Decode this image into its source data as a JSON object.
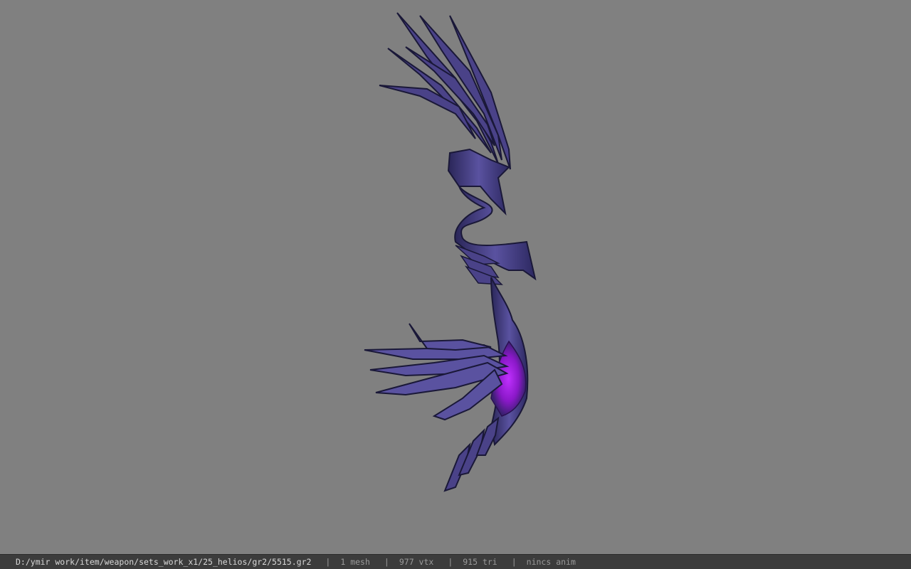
{
  "viewer": {
    "background_color": "#808080",
    "model_colors": {
      "body": "#4a4288",
      "highlight": "#7a72c0",
      "shadow": "#1a1838",
      "glow": "#a020e0"
    }
  },
  "status_bar": {
    "file_path": "D:/ymir work/item/weapon/sets_work_x1/25_helios/gr2/5515.gr2",
    "separator": "|",
    "mesh_count": "1 mesh",
    "vertex_count": "977 vtx",
    "triangle_count": "915 tri",
    "animation": "nincs anim"
  }
}
